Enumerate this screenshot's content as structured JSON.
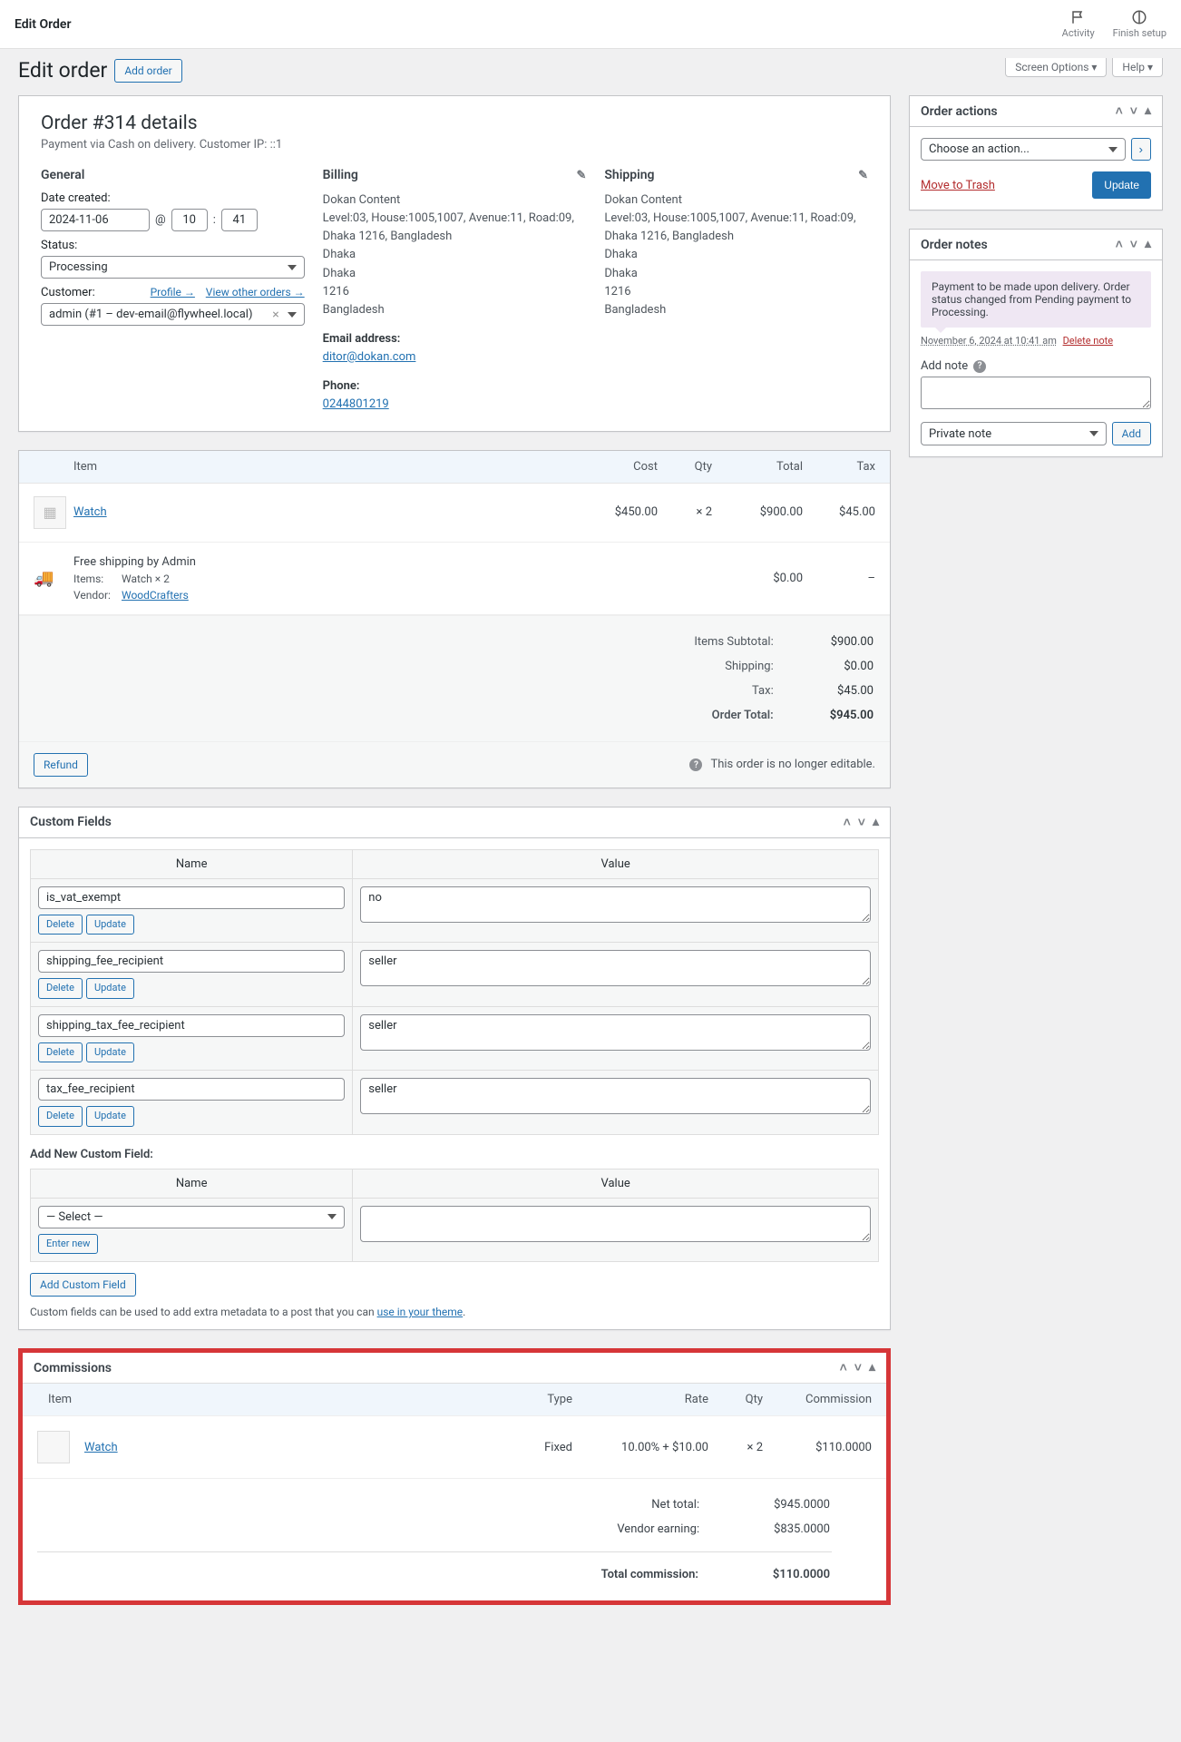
{
  "topbar": {
    "title": "Edit Order",
    "activity": "Activity",
    "finish": "Finish setup"
  },
  "header": {
    "page_title": "Edit order",
    "add_order": "Add order",
    "screen_options": "Screen Options ▾",
    "help": "Help ▾"
  },
  "order": {
    "title": "Order #314 details",
    "subtitle": "Payment via Cash on delivery. Customer IP: ::1",
    "general": {
      "heading": "General",
      "date_label": "Date created:",
      "date": "2024-11-06",
      "at": "@",
      "hour": "10",
      "colon": ":",
      "minute": "41",
      "status_label": "Status:",
      "status": "Processing",
      "customer_label": "Customer:",
      "profile_link": "Profile →",
      "other_orders_link": "View other orders →",
      "customer_value": "admin (#1 – dev-email@flywheel.local)"
    },
    "billing": {
      "heading": "Billing",
      "name": "Dokan Content",
      "line1": "Level:03, House:1005,1007, Avenue:11, Road:09, Dhaka 1216, Bangladesh",
      "line2": "Dhaka",
      "line3": "Dhaka",
      "line4": "1216",
      "line5": "Bangladesh",
      "email_label": "Email address:",
      "email": "ditor@dokan.com",
      "phone_label": "Phone:",
      "phone": "0244801219"
    },
    "shipping": {
      "heading": "Shipping",
      "name": "Dokan Content",
      "line1": "Level:03, House:1005,1007, Avenue:11, Road:09, Dhaka 1216, Bangladesh",
      "line2": "Dhaka",
      "line3": "Dhaka",
      "line4": "1216",
      "line5": "Bangladesh"
    }
  },
  "items": {
    "head": {
      "item": "Item",
      "cost": "Cost",
      "qty": "Qty",
      "total": "Total",
      "tax": "Tax"
    },
    "product": {
      "name": "Watch",
      "cost": "$450.00",
      "qty_pre": "×",
      "qty": "2",
      "total": "$900.00",
      "tax": "$45.00"
    },
    "shipping_line": {
      "name": "Free shipping by Admin",
      "items_label": "Items:",
      "items_val": "Watch × 2",
      "vendor_label": "Vendor:",
      "vendor_val": "WoodCrafters",
      "total": "$0.00",
      "tax": "–"
    },
    "totals": {
      "subtotal_label": "Items Subtotal:",
      "subtotal": "$900.00",
      "shipping_label": "Shipping:",
      "shipping": "$0.00",
      "tax_label": "Tax:",
      "tax": "$45.00",
      "order_total_label": "Order Total:",
      "order_total": "$945.00"
    },
    "refund_btn": "Refund",
    "no_edit": "This order is no longer editable."
  },
  "custom_fields": {
    "title": "Custom Fields",
    "name_head": "Name",
    "value_head": "Value",
    "fields": [
      {
        "name": "is_vat_exempt",
        "value": "no"
      },
      {
        "name": "shipping_fee_recipient",
        "value": "seller"
      },
      {
        "name": "shipping_tax_fee_recipient",
        "value": "seller"
      },
      {
        "name": "tax_fee_recipient",
        "value": "seller"
      }
    ],
    "delete": "Delete",
    "update": "Update",
    "add_title": "Add New Custom Field:",
    "select_placeholder": "— Select —",
    "enter_new": "Enter new",
    "add_btn": "Add Custom Field",
    "hint_pre": "Custom fields can be used to add extra metadata to a post that you can ",
    "hint_link": "use in your theme"
  },
  "commissions": {
    "title": "Commissions",
    "head": {
      "item": "Item",
      "type": "Type",
      "rate": "Rate",
      "qty": "Qty",
      "comm": "Commission"
    },
    "row": {
      "name": "Watch",
      "type": "Fixed",
      "rate": "10.00% + $10.00",
      "qty_pre": "×",
      "qty": "2",
      "comm": "$110.0000"
    },
    "totals": {
      "net_label": "Net total:",
      "net": "$945.0000",
      "vendor_label": "Vendor earning:",
      "vendor": "$835.0000",
      "total_label": "Total commission:",
      "total": "$110.0000"
    }
  },
  "order_actions": {
    "title": "Order actions",
    "choose": "Choose an action...",
    "trash": "Move to Trash",
    "update": "Update"
  },
  "order_notes": {
    "title": "Order notes",
    "note_text": "Payment to be made upon delivery. Order status changed from Pending payment to Processing.",
    "note_date": "November 6, 2024 at 10:41 am",
    "delete_note": "Delete note",
    "add_label": "Add note",
    "note_type": "Private note",
    "add_btn": "Add"
  }
}
